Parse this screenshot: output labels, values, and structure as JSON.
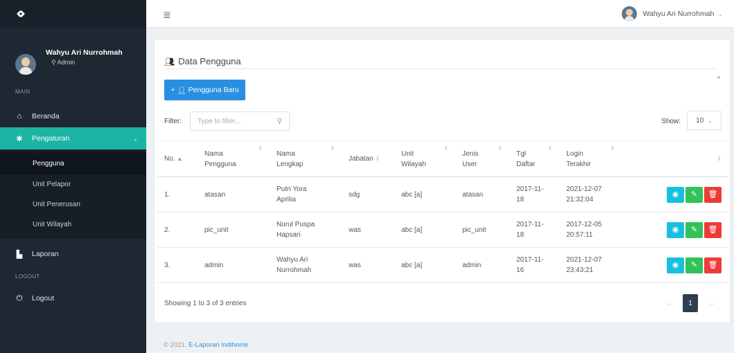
{
  "sidebar": {
    "user_name": "Wahyu Ari Nurrohmah",
    "user_role": "Admin",
    "section_main": "MAIN",
    "section_logout": "LOGOUT",
    "items": [
      {
        "label": "Beranda",
        "icon": "home-icon"
      },
      {
        "label": "Pengaturan",
        "icon": "gear-icon"
      },
      {
        "label": "Laporan",
        "icon": "report-icon"
      },
      {
        "label": "Logout",
        "icon": "power-icon"
      }
    ],
    "sub_items": [
      "Pengguna",
      "Unit Pelapor",
      "Unit Penerusan",
      "Unit Wilayah"
    ]
  },
  "topbar": {
    "user_name": "Wahyu Ari Nurrohmah"
  },
  "card": {
    "title": "Data Pengguna",
    "new_button": "Pengguna Baru",
    "filter_label": "Filter:",
    "filter_placeholder": "Type to filter...",
    "show_label": "Show:",
    "show_value": "10"
  },
  "table": {
    "headers": [
      "No.",
      "Nama Pengguna",
      "Nama Lengkap",
      "Jabatan",
      "Unit Wilayah",
      "Jenis User",
      "Tgl Daftar",
      "Login Terakhir"
    ],
    "rows": [
      {
        "no": "1.",
        "username": "atasan",
        "fullname": "Putri Yora Aprilia",
        "jabatan": "sdg",
        "unit": "abc [a]",
        "jenis": "atasan",
        "tgl": "2017-11-18",
        "login": "2021-12-07 21:32:04"
      },
      {
        "no": "2.",
        "username": "pic_unit",
        "fullname": "Nurul Puspa Hapsari",
        "jabatan": "was",
        "unit": "abc [a]",
        "jenis": "pic_unit",
        "tgl": "2017-11-18",
        "login": "2017-12-05 20:57:11"
      },
      {
        "no": "3.",
        "username": "admin",
        "fullname": "Wahyu Ari Nurrohmah",
        "jabatan": "was",
        "unit": "abc [a]",
        "jenis": "admin",
        "tgl": "2017-11-16",
        "login": "2021-12-07 23:43:21"
      }
    ]
  },
  "pagination": {
    "info": "Showing 1 to 3 of 3 entries",
    "current_page": "1"
  },
  "footer": {
    "prefix": "© 2021.",
    "link": "E-Laporan Indihome"
  },
  "colors": {
    "sidebar_bg": "#1e2832",
    "accent_teal": "#1cb5a3",
    "primary_blue": "#2a8fe0",
    "view_button": "#16c0de",
    "edit_button": "#31c25a",
    "delete_button": "#ee3b38"
  }
}
